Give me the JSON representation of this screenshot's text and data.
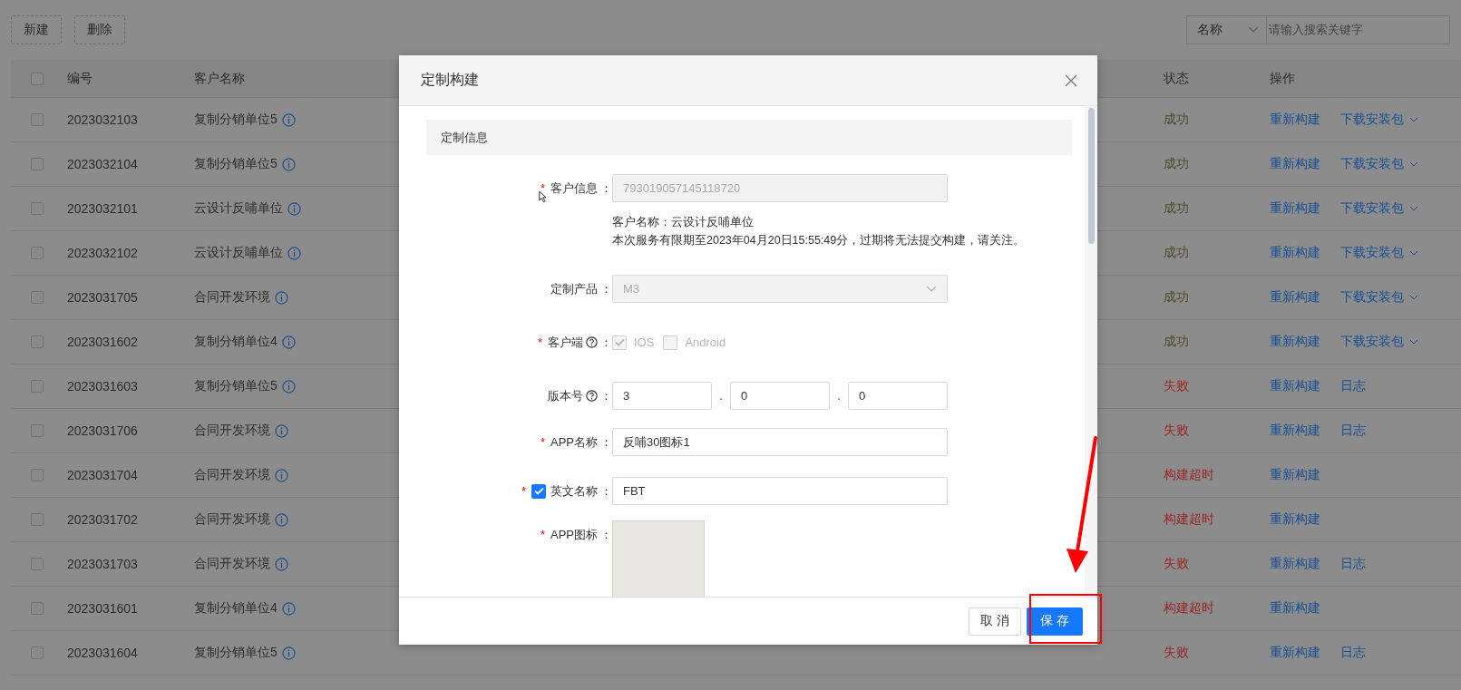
{
  "toolbar": {
    "buttons": [
      "新建",
      "删除"
    ],
    "search": {
      "field": "名称",
      "placeholder": "请输入搜索关键字"
    }
  },
  "table": {
    "columns": [
      "编号",
      "客户名称",
      "状态",
      "操作"
    ],
    "header_checked": false,
    "rows": [
      {
        "checked": false,
        "id": "2023032103",
        "customer": "复制分销单位5",
        "status": {
          "label": "成功",
          "kind": "success"
        },
        "actions": [
          {
            "label": "重新构建",
            "kind": "link"
          },
          {
            "label": "下载安装包",
            "kind": "dropdown"
          }
        ]
      },
      {
        "checked": false,
        "id": "2023032104",
        "customer": "复制分销单位5",
        "status": {
          "label": "成功",
          "kind": "success"
        },
        "actions": [
          {
            "label": "重新构建",
            "kind": "link"
          },
          {
            "label": "下载安装包",
            "kind": "dropdown"
          }
        ]
      },
      {
        "checked": false,
        "id": "2023032101",
        "customer": "云设计反哺单位",
        "status": {
          "label": "成功",
          "kind": "success"
        },
        "actions": [
          {
            "label": "重新构建",
            "kind": "link"
          },
          {
            "label": "下载安装包",
            "kind": "dropdown"
          }
        ]
      },
      {
        "checked": false,
        "id": "2023032102",
        "customer": "云设计反哺单位",
        "status": {
          "label": "成功",
          "kind": "success"
        },
        "actions": [
          {
            "label": "重新构建",
            "kind": "link"
          },
          {
            "label": "下载安装包",
            "kind": "dropdown"
          }
        ]
      },
      {
        "checked": false,
        "id": "2023031705",
        "customer": "合同开发环境",
        "status": {
          "label": "成功",
          "kind": "success"
        },
        "actions": [
          {
            "label": "重新构建",
            "kind": "link"
          },
          {
            "label": "下载安装包",
            "kind": "dropdown"
          }
        ]
      },
      {
        "checked": false,
        "id": "2023031602",
        "customer": "复制分销单位4",
        "status": {
          "label": "成功",
          "kind": "success"
        },
        "actions": [
          {
            "label": "重新构建",
            "kind": "link"
          },
          {
            "label": "下载安装包",
            "kind": "dropdown"
          }
        ]
      },
      {
        "checked": false,
        "id": "2023031603",
        "customer": "复制分销单位5",
        "status": {
          "label": "失败",
          "kind": "failed"
        },
        "actions": [
          {
            "label": "重新构建",
            "kind": "link"
          },
          {
            "label": "日志",
            "kind": "link"
          }
        ]
      },
      {
        "checked": false,
        "id": "2023031706",
        "customer": "合同开发环境",
        "status": {
          "label": "失败",
          "kind": "failed"
        },
        "actions": [
          {
            "label": "重新构建",
            "kind": "link"
          },
          {
            "label": "日志",
            "kind": "link"
          }
        ]
      },
      {
        "checked": false,
        "id": "2023031704",
        "customer": "合同开发环境",
        "status": {
          "label": "构建超时",
          "kind": "timeout"
        },
        "actions": [
          {
            "label": "重新构建",
            "kind": "link"
          }
        ]
      },
      {
        "checked": false,
        "id": "2023031702",
        "customer": "合同开发环境",
        "status": {
          "label": "构建超时",
          "kind": "timeout"
        },
        "actions": [
          {
            "label": "重新构建",
            "kind": "link"
          }
        ]
      },
      {
        "checked": false,
        "id": "2023031703",
        "customer": "合同开发环境",
        "status": {
          "label": "失败",
          "kind": "failed"
        },
        "actions": [
          {
            "label": "重新构建",
            "kind": "link"
          },
          {
            "label": "日志",
            "kind": "link"
          }
        ]
      },
      {
        "checked": false,
        "id": "2023031601",
        "customer": "复制分销单位4",
        "status": {
          "label": "构建超时",
          "kind": "timeout"
        },
        "actions": [
          {
            "label": "重新构建",
            "kind": "link"
          }
        ]
      },
      {
        "checked": false,
        "id": "2023031604",
        "customer": "复制分销单位5",
        "status": {
          "label": "失败",
          "kind": "failed"
        },
        "actions": [
          {
            "label": "重新构建",
            "kind": "link"
          },
          {
            "label": "日志",
            "kind": "link"
          }
        ]
      }
    ]
  },
  "dialog": {
    "title": "定制构建",
    "section": "定制信息",
    "fields": [
      {
        "kind": "text",
        "mark": "*",
        "label": "客户信息",
        "colon": "：",
        "value": "793019057145118720",
        "disabled": true,
        "notes": [
          "客户名称：云设计反哺单位",
          "本次服务有限期至2023年04月20日15:55:49分，过期将无法提交构建，请关注。"
        ]
      },
      {
        "kind": "select",
        "label": "定制产品",
        "colon": "：",
        "value": "M3",
        "disabled": true
      },
      {
        "kind": "checkboxes",
        "mark": "*",
        "label": "客户端",
        "help": true,
        "colon": "：",
        "disabled": true,
        "options": [
          {
            "label": "IOS",
            "checked": true
          },
          {
            "label": "Android",
            "checked": false
          }
        ]
      },
      {
        "kind": "version",
        "label": "版本号",
        "help": true,
        "colon": "：",
        "parts": [
          "3",
          "0",
          "0"
        ],
        "separators": [
          ".",
          "."
        ]
      },
      {
        "kind": "text",
        "mark": "*",
        "label": "APP名称",
        "colon": "：",
        "value": "反哺30图标1",
        "disabled": false
      },
      {
        "kind": "text",
        "mark": "*",
        "label": "英文名称",
        "toggle": true,
        "colon": " ：",
        "value": "FBT",
        "disabled": false
      },
      {
        "kind": "image",
        "mark": "*",
        "label": "APP图标",
        "colon": "："
      }
    ],
    "buttons": [
      {
        "label": "取 消",
        "kind": "default"
      },
      {
        "label": "保 存",
        "kind": "primary"
      }
    ]
  }
}
